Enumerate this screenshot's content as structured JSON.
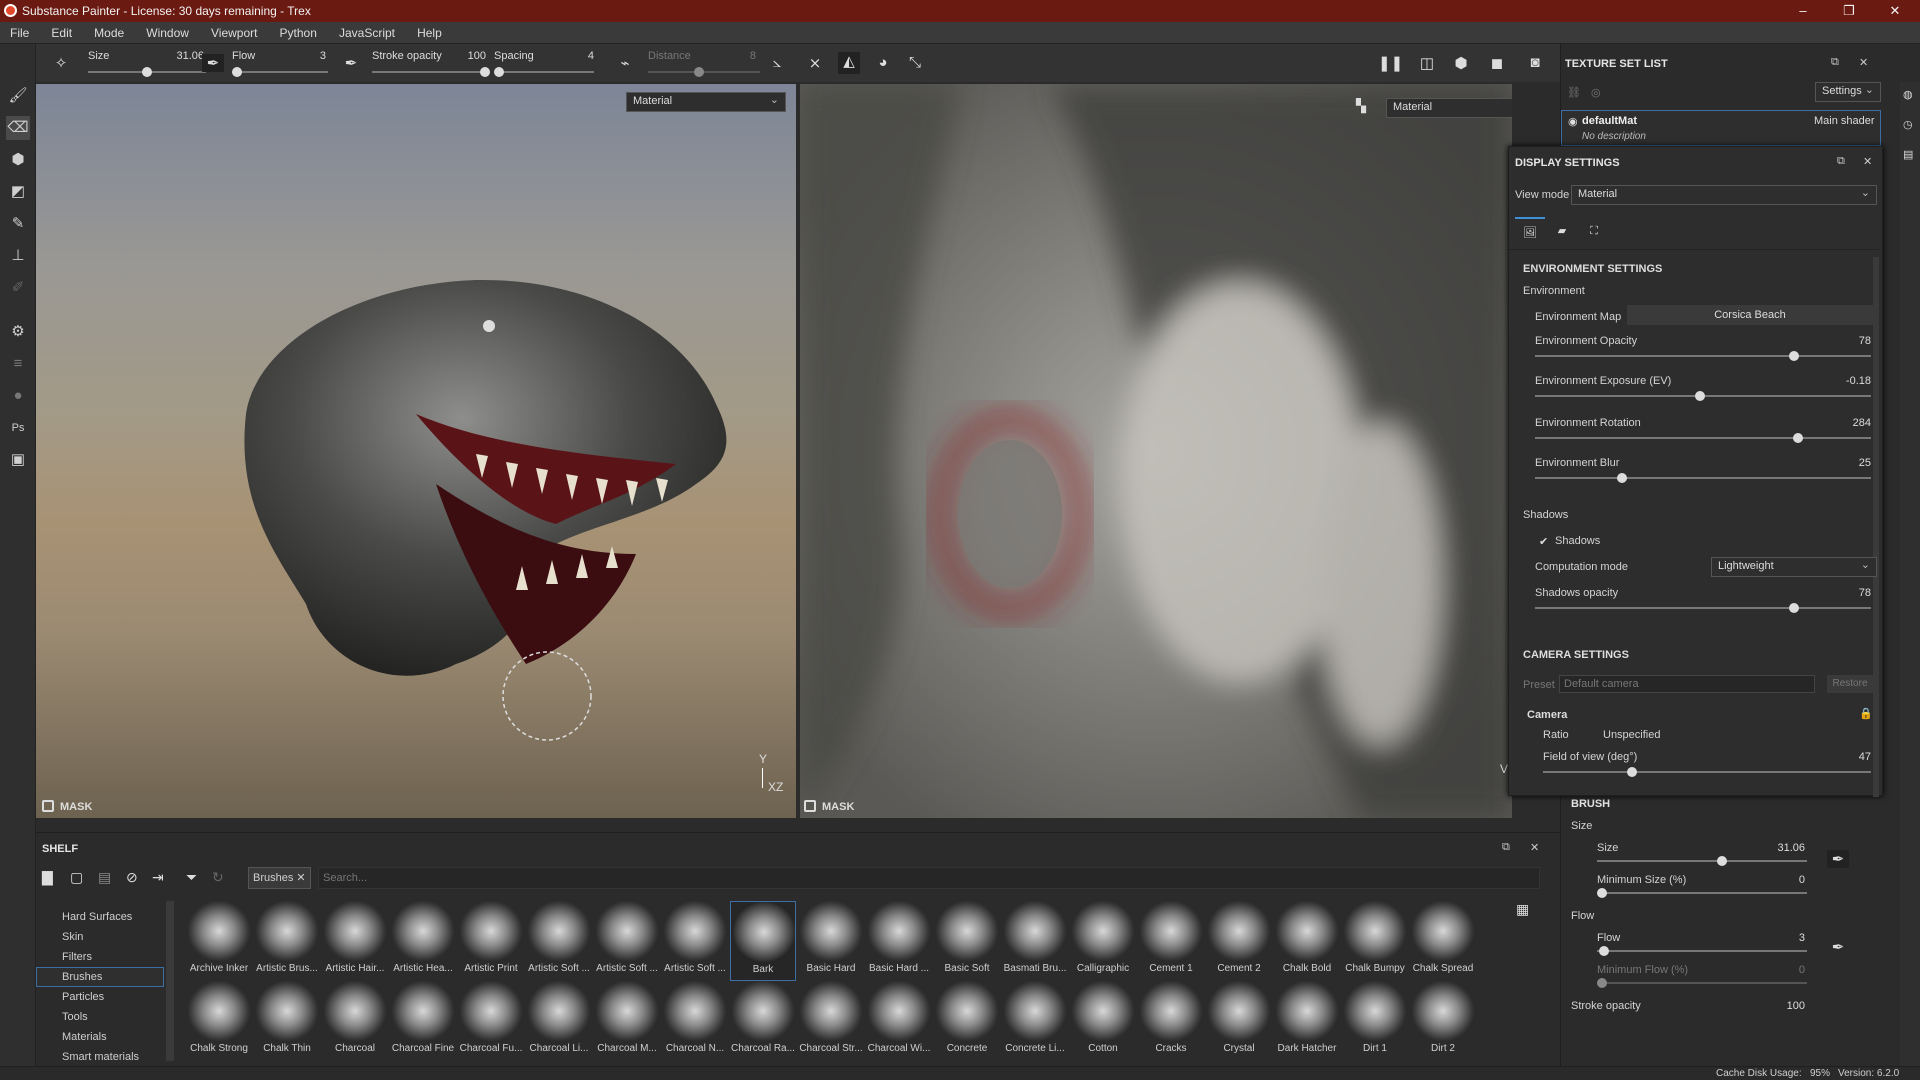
{
  "app": {
    "title": "Substance Painter - License: 30 days remaining - Trex"
  },
  "menu": [
    "File",
    "Edit",
    "Mode",
    "Window",
    "Viewport",
    "Python",
    "JavaScript",
    "Help"
  ],
  "toolbar": {
    "size_label": "Size",
    "size_value": "31.06",
    "flow_label": "Flow",
    "flow_value": "3",
    "stroke_opacity_label": "Stroke opacity",
    "stroke_opacity_value": "100",
    "spacing_label": "Spacing",
    "spacing_value": "4",
    "distance_label": "Distance",
    "distance_value": "8"
  },
  "viewport_left": {
    "mode": "Material",
    "mask": "MASK",
    "axis_y": "Y",
    "axis_xz": "XZ"
  },
  "viewport_right": {
    "mode": "Material",
    "mask": "MASK",
    "axis_v": "V"
  },
  "texture_set": {
    "header": "TEXTURE SET LIST",
    "settings": "Settings",
    "name": "defaultMat",
    "shader": "Main shader",
    "description": "No description"
  },
  "display": {
    "header": "DISPLAY SETTINGS",
    "view_mode_label": "View mode",
    "view_mode": "Material",
    "env_header": "ENVIRONMENT SETTINGS",
    "env_group": "Environment",
    "env_map_label": "Environment Map",
    "env_map": "Corsica Beach",
    "env_opacity_label": "Environment Opacity",
    "env_opacity": "78",
    "env_opacity_pct": 0.78,
    "env_exposure_label": "Environment Exposure (EV)",
    "env_exposure": "-0.18",
    "env_exposure_pct": 0.49,
    "env_rotation_label": "Environment Rotation",
    "env_rotation": "284",
    "env_rotation_pct": 0.79,
    "env_blur_label": "Environment Blur",
    "env_blur": "25",
    "env_blur_pct": 0.25,
    "shadows_group": "Shadows",
    "shadows_check": "Shadows",
    "computation_label": "Computation mode",
    "computation": "Lightweight",
    "shadow_opacity_label": "Shadows opacity",
    "shadow_opacity": "78",
    "shadow_opacity_pct": 0.78,
    "camera_header": "CAMERA SETTINGS",
    "preset_label": "Preset",
    "preset": "Default camera",
    "restore": "Restore",
    "camera_group": "Camera",
    "ratio_label": "Ratio",
    "ratio": "Unspecified",
    "fov_label": "Field of view (deg°)",
    "fov": "47"
  },
  "brush": {
    "header": "BRUSH",
    "size_group": "Size",
    "size_label": "Size",
    "size": "31.06",
    "min_size_label": "Minimum Size (%)",
    "min_size": "0",
    "flow_group": "Flow",
    "flow_label": "Flow",
    "flow": "3",
    "min_flow_label": "Minimum Flow (%)",
    "min_flow": "0",
    "stroke_opacity_label": "Stroke opacity",
    "stroke_opacity": "100"
  },
  "shelf": {
    "header": "SHELF",
    "filter_tag": "Brushes",
    "search_placeholder": "Search...",
    "categories": [
      "Hard Surfaces",
      "Skin",
      "Filters",
      "Brushes",
      "Particles",
      "Tools",
      "Materials",
      "Smart materials"
    ],
    "row1": [
      "Archive Inker",
      "Artistic Brus...",
      "Artistic Hair...",
      "Artistic Hea...",
      "Artistic Print",
      "Artistic Soft ...",
      "Artistic Soft ...",
      "Artistic Soft ...",
      "Bark",
      "Basic Hard",
      "Basic Hard ...",
      "Basic Soft",
      "Basmati Bru...",
      "Calligraphic",
      "Cement 1",
      "Cement 2",
      "Chalk Bold",
      "Chalk Bumpy",
      "Chalk Spread"
    ],
    "row2": [
      "Chalk Strong",
      "Chalk Thin",
      "Charcoal",
      "Charcoal Fine",
      "Charcoal Fu...",
      "Charcoal Li...",
      "Charcoal M...",
      "Charcoal N...",
      "Charcoal Ra...",
      "Charcoal Str...",
      "Charcoal Wi...",
      "Concrete",
      "Concrete Li...",
      "Cotton",
      "Cracks",
      "Crystal",
      "Dark Hatcher",
      "Dirt 1",
      "Dirt 2"
    ]
  },
  "status": {
    "cache": "Cache Disk Usage:",
    "cache_value": "95%",
    "version": "Version: 6.2.0"
  }
}
